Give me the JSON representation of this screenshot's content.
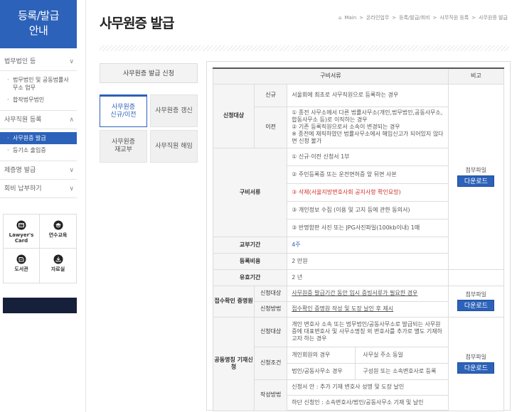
{
  "sidebar": {
    "header": [
      "등록/발급",
      "안내"
    ],
    "menu1": "법무법인 등",
    "menu1_sub": [
      "법무법인 및 공동법률사무소 업무",
      "합작법무법인"
    ],
    "menu2": "사무직원 등록",
    "menu2_sub": [
      "사무원증 발급",
      "등기소 출입증"
    ],
    "menu3": "제증명 발급",
    "menu4": "회비 납부하기",
    "icons": [
      {
        "label": [
          "Lawyer's",
          "Card"
        ],
        "icon": "card-icon"
      },
      {
        "label": [
          "연수교육"
        ],
        "icon": "graduation-icon"
      },
      {
        "label": [
          "도서관"
        ],
        "icon": "book-icon"
      },
      {
        "label": [
          "자료실"
        ],
        "icon": "download-icon"
      }
    ]
  },
  "header": {
    "title": "사무원증 발급",
    "breadcrumb": [
      "Main",
      "온라인업무",
      "등록/발급/회비",
      "사무직원 등록",
      "사무원증 발급"
    ]
  },
  "tabs": {
    "apply": "사무원증 발급 신청",
    "items": [
      {
        "label": [
          "사무원증",
          "신규/이전"
        ],
        "active": true
      },
      {
        "label": [
          "사무원증 갱신"
        ],
        "active": false
      },
      {
        "label": [
          "사무원증",
          "재교부"
        ],
        "active": false
      },
      {
        "label": [
          "사무직원 해임"
        ],
        "active": false
      }
    ]
  },
  "table": {
    "head_docs": "구비서류",
    "head_note": "비고",
    "target": "신청대상",
    "new": "신규",
    "new_desc": "서울회에 최초로 사무직원으로 등록하는 경우",
    "transfer": "이전",
    "transfer_desc": "① 종전 사무소에서 다른 법률사무소(개인,법무법인,공동사무소, 합동사무소 등)로 이직하는 경우\n② 기존 등록직원으로서 소속이 변경되는 경우\n※ 종전에 재직하였던 법률사무소에서 해임신고가 되어있지 않다면 신청 불가",
    "docs": "구비서류",
    "doc1": "① 신규·이전 신청서 1부",
    "doc2": "② 주민등록증 또는 운전면허증 앞 뒤면 사본",
    "doc3": "③ 삭제(서울지방변호사회 공지사항 확인요망)",
    "doc4": "③ 개인정보 수집 (이용 및 고지 등에 관한 동의서)",
    "doc5": "③ 반명함판 사진 또는 JPG사진파일(100kb이내) 1매",
    "attach": "첨부파일",
    "download": "다운로드",
    "period_label": "교부기간",
    "period": "4주",
    "fee_label": "등록비용",
    "fee": "2 만원",
    "valid_label": "유효기간",
    "valid": "2 년",
    "receipt": "접수확인 증명원",
    "receipt_target": "신청대상",
    "receipt_target_desc": "사무원증 발급기간 동안 임시 증빙서류가 필요한 경우",
    "receipt_method": "신청방법",
    "receipt_method_desc": "접수확인 증명원 작성 및 도장 날인 후 제시",
    "joint": "공동명칭 기재신청",
    "joint_target": "신청대상",
    "joint_target_desc": "개인 변호사 소속 또는 법무법인/공동사무소로 발급되는 사무원증에 대표변호사 및 사무소명칭 외 변호사를 추가로 별도 기재하고자 하는 경우",
    "joint_cond": "신청조건",
    "cond1": "개인회원의 경우",
    "cond2": "사무실 주소 동일",
    "cond3": "법인/공동사무소 경우",
    "cond4": "구성원 또는 소속변호사로 등록",
    "joint_method": "작성방법",
    "method1": "신청서 안 : 추가 기재 변호사 성명 및 도장 날인",
    "method2": "하단 신청인 : 소속변호사/법인/공동사무소 기재 및 날인"
  }
}
